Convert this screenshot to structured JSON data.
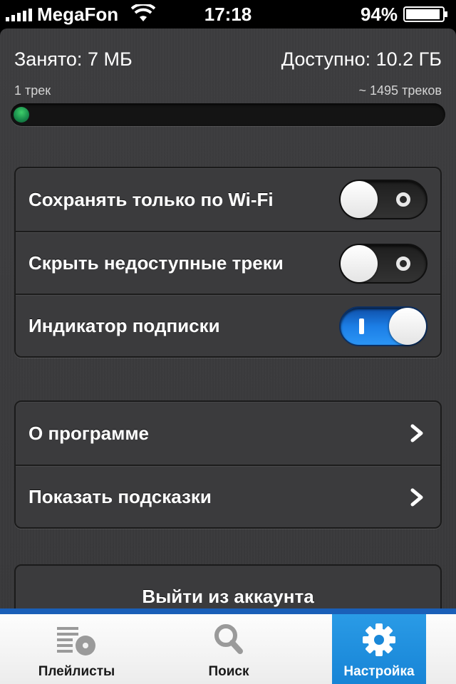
{
  "status_bar": {
    "carrier": "MegaFon",
    "time": "17:18",
    "battery": "94%",
    "battery_level": 0.94
  },
  "storage": {
    "used_label": "Занято: 7 МБ",
    "available_label": "Доступно: 10.2 ГБ",
    "tracks_used": "1 трек",
    "tracks_available": "~ 1495 треков",
    "progress_fraction": 0.0007
  },
  "settings": {
    "toggles": [
      {
        "label": "Сохранять только по Wi-Fi",
        "state": "off"
      },
      {
        "label": "Скрыть недоступные треки",
        "state": "off"
      },
      {
        "label": "Индикатор подписки",
        "state": "on"
      }
    ],
    "links": [
      {
        "label": "О программе",
        "icon": "chevron-right-icon"
      },
      {
        "label": "Показать подсказки",
        "icon": "chevron-right-icon"
      }
    ],
    "logout_label": "Выйти из аккаунта"
  },
  "tabbar": {
    "tabs": [
      {
        "label": "Плейлисты",
        "icon": "playlists-icon",
        "active": false
      },
      {
        "label": "Поиск",
        "icon": "search-icon",
        "active": false
      },
      {
        "label": "Настройка",
        "icon": "gear-icon",
        "active": true
      }
    ],
    "active_color": "#1784d6"
  },
  "colors": {
    "toggle_on": "#1c7ee6",
    "progress_fill": "#17884a",
    "background": "#3a3a3c"
  }
}
